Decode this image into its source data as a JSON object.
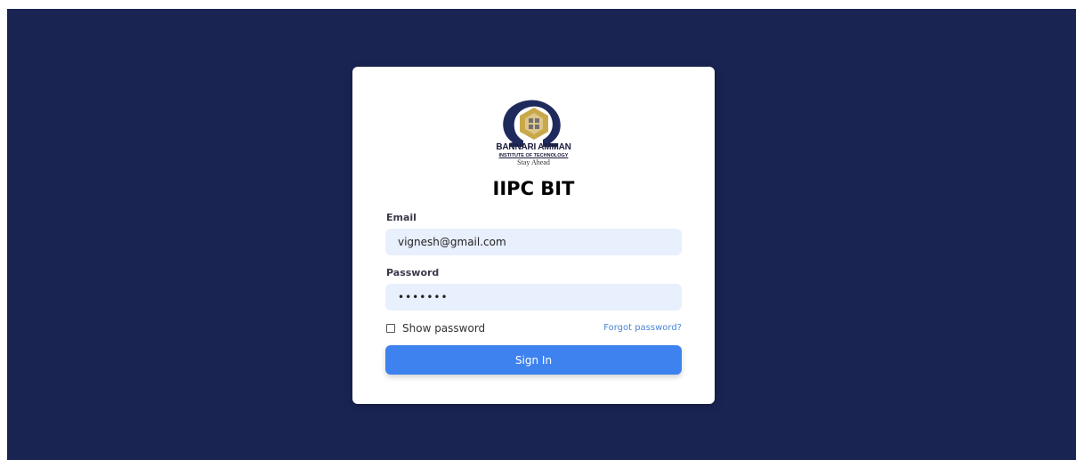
{
  "logo": {
    "name": "BANNARI AMMAN",
    "subtitle": "INSTITUTE OF TECHNOLOGY",
    "tagline": "Stay Ahead"
  },
  "title": "IIPC BIT",
  "form": {
    "email_label": "Email",
    "email_value": "vignesh@gmail.com",
    "password_label": "Password",
    "password_value": "•••••••",
    "show_password_label": "Show password",
    "forgot_password_label": "Forgot password?",
    "sign_in_label": "Sign In"
  },
  "colors": {
    "background": "#192453",
    "card": "#ffffff",
    "input_bg": "#e8effd",
    "primary_button": "#3e82f0",
    "link": "#4a86d8",
    "logo_navy": "#1f2a5c",
    "logo_gold": "#c9a84a"
  }
}
